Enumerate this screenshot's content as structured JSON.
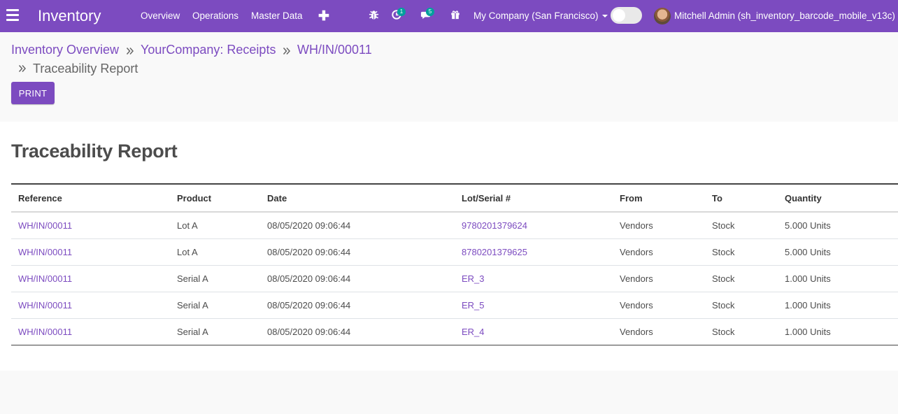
{
  "navbar": {
    "app_name": "Inventory",
    "menus": [
      "Overview",
      "Operations",
      "Master Data"
    ],
    "activity_badge": "1",
    "messages_badge": "5",
    "company": "My Company (San Francisco)",
    "user": "Mitchell Admin (sh_inventory_barcode_mobile_v13c)",
    "accent_color": "#7c4bc0"
  },
  "breadcrumb": {
    "items": [
      "Inventory Overview",
      "YourCompany: Receipts",
      "WH/IN/00011"
    ],
    "active": "Traceability Report"
  },
  "buttons": {
    "print": "PRINT"
  },
  "report": {
    "title": "Traceability Report",
    "columns": [
      "Reference",
      "Product",
      "Date",
      "Lot/Serial #",
      "From",
      "To",
      "Quantity"
    ],
    "rows": [
      [
        "WH/IN/00011",
        "Lot A",
        "08/05/2020 09:06:44",
        "9780201379624",
        "Vendors",
        "Stock",
        "5.000 Units"
      ],
      [
        "WH/IN/00011",
        "Lot A",
        "08/05/2020 09:06:44",
        "8780201379625",
        "Vendors",
        "Stock",
        "5.000 Units"
      ],
      [
        "WH/IN/00011",
        "Serial A",
        "08/05/2020 09:06:44",
        "ER_3",
        "Vendors",
        "Stock",
        "1.000 Units"
      ],
      [
        "WH/IN/00011",
        "Serial A",
        "08/05/2020 09:06:44",
        "ER_5",
        "Vendors",
        "Stock",
        "1.000 Units"
      ],
      [
        "WH/IN/00011",
        "Serial A",
        "08/05/2020 09:06:44",
        "ER_4",
        "Vendors",
        "Stock",
        "1.000 Units"
      ]
    ]
  }
}
